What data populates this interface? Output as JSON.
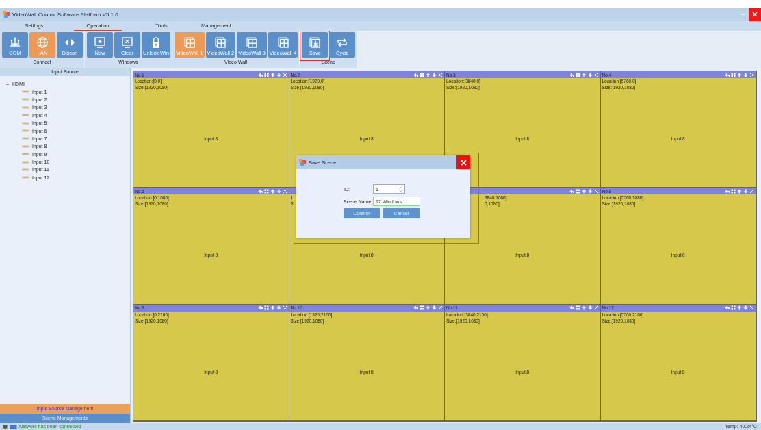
{
  "window": {
    "title": "VideoWall Control Software Platform V5.1.0"
  },
  "menu_tabs": [
    {
      "label": "Settings",
      "selected": false
    },
    {
      "label": "Operation",
      "selected": true
    },
    {
      "label": "Tools",
      "selected": false
    },
    {
      "label": "Management",
      "selected": false
    }
  ],
  "ribbon": [
    {
      "label": "Connect",
      "buttons": [
        {
          "label": "COM",
          "selected": false,
          "highlighted": false
        },
        {
          "label": "LAN",
          "selected": true,
          "highlighted": false
        },
        {
          "label": "Discon",
          "selected": false,
          "highlighted": false
        }
      ]
    },
    {
      "label": "Windows",
      "buttons": [
        {
          "label": "New",
          "selected": false,
          "highlighted": false
        },
        {
          "label": "Clear",
          "selected": false,
          "highlighted": false
        },
        {
          "label": "Unlock Win",
          "selected": false,
          "highlighted": false
        }
      ]
    },
    {
      "label": "Video Wall",
      "buttons": [
        {
          "label": "VideoWall 1",
          "selected": true,
          "highlighted": false
        },
        {
          "label": "VideoWall 2",
          "selected": false,
          "highlighted": false
        },
        {
          "label": "VideoWall 3",
          "selected": false,
          "highlighted": false
        },
        {
          "label": "VideoWall 4",
          "selected": false,
          "highlighted": false
        }
      ]
    },
    {
      "label": "Scene",
      "buttons": [
        {
          "label": "Save",
          "selected": false,
          "highlighted": true
        },
        {
          "label": "Cycle",
          "selected": false,
          "highlighted": false
        }
      ]
    }
  ],
  "sidebar": {
    "title": "Input Source",
    "tree": [
      {
        "label": "HDMI",
        "expanded": true,
        "children": [
          {
            "label": "Input 1"
          },
          {
            "label": "Input 2"
          },
          {
            "label": "Input 3"
          },
          {
            "label": "Input 4"
          },
          {
            "label": "Input 5"
          },
          {
            "label": "Input 6"
          },
          {
            "label": "Input 7"
          },
          {
            "label": "Input 8"
          },
          {
            "label": "Input 9"
          },
          {
            "label": "Input 10"
          },
          {
            "label": "Input 11"
          },
          {
            "label": "Input 12"
          }
        ]
      }
    ],
    "buttons": [
      {
        "label": "Input Source Management",
        "selected": true
      },
      {
        "label": "Scene Managements",
        "selected": false
      }
    ]
  },
  "tiles": [
    {
      "title": "No.1",
      "location": "Location:[0,0]",
      "size": "Size:[1920,1080]",
      "source": "Input 8",
      "kind": "full"
    },
    {
      "title": "No.2",
      "location": "Location:[1920,0]",
      "size": "Size:[1920,1080]",
      "source": "Input 8",
      "kind": "full"
    },
    {
      "title": "No.3",
      "location": "Location:[3840,0]",
      "size": "Size:[1920,1080]",
      "source": "Input 8",
      "kind": "full"
    },
    {
      "title": "No.4",
      "location": "Location:[5760,0]",
      "size": "Size:[1920,1080]",
      "source": "Input 8",
      "kind": "full"
    },
    {
      "title": "No.5",
      "location": "Location:[0,1080]",
      "size": "Size:[1920,1080]",
      "source": "Input 8",
      "kind": "full"
    },
    {
      "location": "L",
      "size": "S",
      "source": "Input 8",
      "kind": "hidden_header"
    },
    {
      "location": "3840,1080]",
      "size": "0,1080]",
      "source": "Input 8",
      "kind": "partly_covered"
    },
    {
      "title": "No.8",
      "location": "Location:[5760,1080]",
      "size": "Size:[1920,1080]",
      "source": "Input 8",
      "kind": "full"
    },
    {
      "title": "No.9",
      "location": "Location:[0,2160]",
      "size": "Size:[1920,1080]",
      "source": "Input 8",
      "kind": "full"
    },
    {
      "title": "No.10",
      "location": "Location:[1920,2160]",
      "size": "Size:[1920,1080]",
      "source": "Input 8",
      "kind": "full"
    },
    {
      "title": "No.11",
      "location": "Location:[3840,2160]",
      "size": "Size:[1920,1080]",
      "source": "Input 8",
      "kind": "full"
    },
    {
      "title": "No.12",
      "location": "Location:[5760,2160]",
      "size": "Size:[1920,1080]",
      "source": "Input 8",
      "kind": "full"
    }
  ],
  "dialog": {
    "title": "Save Scene",
    "highlighted": true,
    "id_label": "ID:",
    "id_value": "1",
    "name_label": "Scene Name:",
    "name_value": "12 Windows",
    "buttons": [
      "Confirm",
      "Cancel"
    ]
  },
  "status_bar": {
    "message": "Network has been connected",
    "temperature": "Temp: 40.24°C"
  }
}
